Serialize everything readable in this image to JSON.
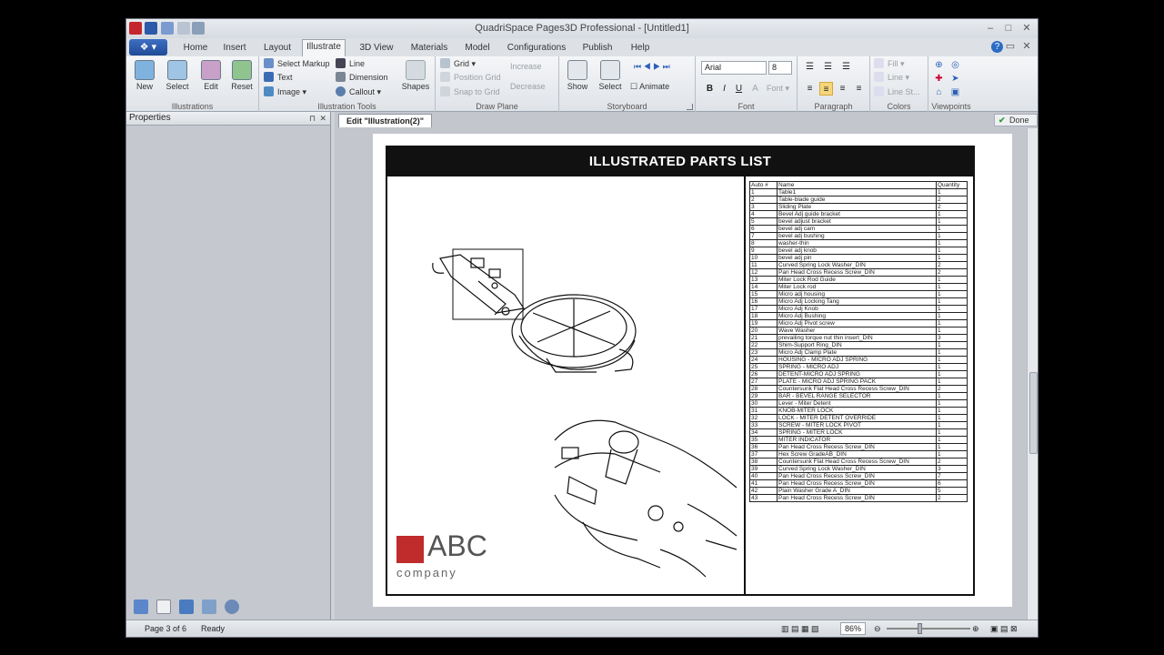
{
  "window": {
    "title": "QuadriSpace Pages3D Professional - [Untitled1]",
    "controls": [
      "–",
      "□",
      "✕"
    ]
  },
  "tabs": [
    {
      "label": "Home"
    },
    {
      "label": "Insert"
    },
    {
      "label": "Layout"
    },
    {
      "label": "Illustrate"
    },
    {
      "label": "3D View"
    },
    {
      "label": "Materials"
    },
    {
      "label": "Model"
    },
    {
      "label": "Configurations"
    },
    {
      "label": "Publish"
    },
    {
      "label": "Help"
    }
  ],
  "ribbon": {
    "illustrations": {
      "label": "Illustrations",
      "buttons": [
        "New",
        "Select",
        "Edit",
        "Reset"
      ]
    },
    "illustration_tools": {
      "label": "Illustration Tools",
      "select_markup": "Select Markup",
      "text": "Text",
      "image": "Image",
      "line": "Line",
      "dimension": "Dimension",
      "callout": "Callout",
      "shapes": "Shapes"
    },
    "draw_plane": {
      "label": "Draw Plane",
      "grid": "Grid",
      "position_grid": "Position Grid",
      "snap_to_grid": "Snap to Grid",
      "increase": "Increase",
      "decrease": "Decrease"
    },
    "storyboard": {
      "label": "Storyboard",
      "show": "Show",
      "select": "Select",
      "animate": "Animate"
    },
    "font": {
      "label": "Font",
      "family": "Arial",
      "size": "8",
      "bold": "B",
      "italic": "I",
      "underline": "U",
      "font_btn": "Font"
    },
    "paragraph": {
      "label": "Paragraph"
    },
    "colors": {
      "label": "Colors",
      "fill": "Fill",
      "line": "Line",
      "line_style": "Line St..."
    },
    "viewpoints": {
      "label": "Viewpoints"
    }
  },
  "properties_panel": {
    "title": "Properties",
    "pin": "⊓",
    "close": "✕"
  },
  "document": {
    "tab_label": "Edit \"Illustration(2)\"",
    "done_label": "Done",
    "header": "ILLUSTRATED PARTS LIST",
    "logo_main": "ABC",
    "logo_sub": "company",
    "parts_columns": [
      "Auto #",
      "Name",
      "Quantity"
    ],
    "parts": [
      [
        "1",
        "Table1",
        "1"
      ],
      [
        "2",
        "Table-blade guide",
        "2"
      ],
      [
        "3",
        "Sliding Plate",
        "2"
      ],
      [
        "4",
        "Bevel Adj guide bracket",
        "1"
      ],
      [
        "5",
        "bevel adjust bracket",
        "1"
      ],
      [
        "6",
        "bevel adj cam",
        "1"
      ],
      [
        "7",
        "bevel adj bushing",
        "1"
      ],
      [
        "8",
        "washer-thin",
        "1"
      ],
      [
        "9",
        "bevel adj knob",
        "1"
      ],
      [
        "10",
        "bevel adj pin",
        "1"
      ],
      [
        "11",
        "Curved Spring Lock Washer_DIN",
        "2"
      ],
      [
        "12",
        "Pan Head Cross Recess Screw_DIN",
        "2"
      ],
      [
        "13",
        "Miter Lock Rod Guide",
        "1"
      ],
      [
        "14",
        "Miter Lock rod",
        "1"
      ],
      [
        "15",
        "Micro adj housing",
        "1"
      ],
      [
        "16",
        "Micro Adj Locking Tang",
        "1"
      ],
      [
        "17",
        "Micro Adj Knob",
        "1"
      ],
      [
        "18",
        "Micro Adj Bushing",
        "1"
      ],
      [
        "19",
        "Micro Adj Pivot screw",
        "1"
      ],
      [
        "20",
        "Wave Washer",
        "1"
      ],
      [
        "21",
        "prevailing torque nut thin insert_DIN",
        "3"
      ],
      [
        "22",
        "Shim-Support Ring_DIN",
        "1"
      ],
      [
        "23",
        "Micro Adj Clamp Plate",
        "1"
      ],
      [
        "24",
        "HOUSING - MICRO ADJ SPRING",
        "1"
      ],
      [
        "25",
        "SPRING - MICRO ADJ",
        "1"
      ],
      [
        "26",
        "DETENT-MICRO ADJ SPRING",
        "1"
      ],
      [
        "27",
        "PLATE - MICRO ADJ SPRING PACK",
        "1"
      ],
      [
        "28",
        "Countersunk Flat Head Cross Recess Screw_DIN",
        "2"
      ],
      [
        "29",
        "BAR - BEVEL RANGE SELECTOR",
        "1"
      ],
      [
        "30",
        "Lever - Miter Detent",
        "1"
      ],
      [
        "31",
        "KNOB-MITER LOCK",
        "1"
      ],
      [
        "32",
        "LOCK - MITER DETENT OVERRIDE",
        "1"
      ],
      [
        "33",
        "SCREW - MITER LOCK PIVOT",
        "1"
      ],
      [
        "34",
        "SPRING - MITER LOCK",
        "1"
      ],
      [
        "35",
        "MITER INDICATOR",
        "1"
      ],
      [
        "36",
        "Pan Head Cross Recess Screw_DIN",
        "1"
      ],
      [
        "37",
        "Hex Screw GradeAB_DIN",
        "1"
      ],
      [
        "38",
        "Countersunk Flat Head Cross Recess Screw_DIN",
        "2"
      ],
      [
        "39",
        "Curved Spring Lock Washer_DIN",
        "3"
      ],
      [
        "40",
        "Pan Head Cross Recess Screw_DIN",
        "7"
      ],
      [
        "41",
        "Pan Head Cross Recess Screw_DIN",
        "6"
      ],
      [
        "42",
        "Plain Washer Grade A_DIN",
        "5"
      ],
      [
        "43",
        "Pan Head Cross Recess Screw_DIN",
        "2"
      ]
    ]
  },
  "status": {
    "page": "Page 3 of 6",
    "state": "Ready",
    "zoom": "86%"
  },
  "colors": {
    "accent": "#2b5fb8",
    "logo_red": "#c02b2b",
    "header_black": "#111111"
  }
}
